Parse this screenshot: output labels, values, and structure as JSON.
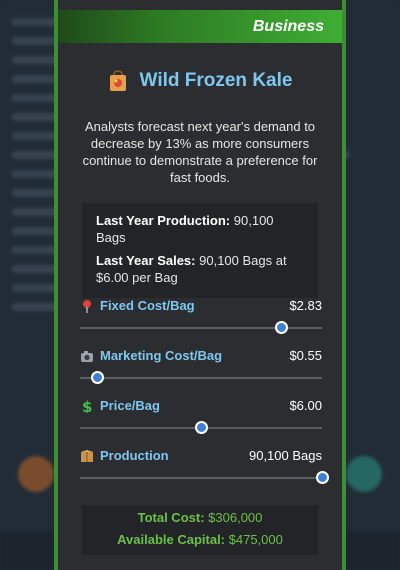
{
  "banner": {
    "label": "Business"
  },
  "product": {
    "name": "Wild Frozen Kale",
    "icon": "grocery-bag-icon"
  },
  "forecast": "Analysts forecast next year's demand to decrease by 13% as more consumers continue to demonstrate a preference for fast foods.",
  "stats": {
    "production_label": "Last Year Production:",
    "production_value": "90,100 Bags",
    "sales_label": "Last Year Sales:",
    "sales_value": "90,100 Bags at $6.00 per Bag"
  },
  "sliders": [
    {
      "label": "Fixed Cost/Bag",
      "value": "$2.83",
      "icon": "pin-icon",
      "position": 0.83
    },
    {
      "label": "Marketing Cost/Bag",
      "value": "$0.55",
      "icon": "camera-icon",
      "position": 0.07
    },
    {
      "label": "Price/Bag",
      "value": "$6.00",
      "icon": "dollar-icon",
      "position": 0.5
    },
    {
      "label": "Production",
      "value": "90,100 Bags",
      "icon": "box-icon",
      "position": 1.0
    }
  ],
  "totals": {
    "cost_label": "Total Cost:",
    "cost_value": "$306,000",
    "capital_label": "Available Capital:",
    "capital_value": "$475,000"
  }
}
